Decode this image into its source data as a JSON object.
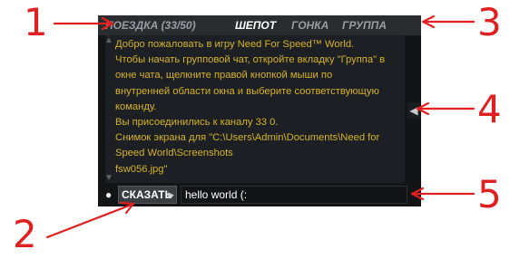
{
  "tabs": [
    {
      "label": "ПОЕЗДКА (33/50)",
      "active": false
    },
    {
      "label": "ШЕПОТ",
      "active": true
    },
    {
      "label": "ГОНКА",
      "active": false
    },
    {
      "label": "ГРУППА",
      "active": false
    }
  ],
  "messages": [
    "Добро пожаловать в игру Need For Speed™ World.",
    "Чтобы начать групповой чат, откройте вкладку \"Группа\" в",
    "окне чата, щелкните правой кнопкой мыши по",
    "внутренней области окна и выберите соответствующую",
    "команду.",
    "Вы присоединились к каналу 33 0.",
    "Снимок экрана для \"C:\\Users\\Admin\\Documents\\Need for",
    "Speed World\\Screenshots",
    "fsw056.jpg\""
  ],
  "input": {
    "say_label": "СКАЗАТЬ",
    "value": "hello world (:"
  },
  "icons": {
    "scroll_up": "chevron-up-icon",
    "scroll_down": "chevron-down-icon",
    "collapse": "chevron-left-icon",
    "say_arrow": "triangle-right-icon",
    "bullet": "bullet-icon"
  },
  "annotations": [
    "1",
    "2",
    "3",
    "4",
    "5"
  ],
  "colors": {
    "message_text": "#d7b227",
    "annotation": "#e02020",
    "active_tab": "#ffffff",
    "inactive_tab": "#9a9ea3"
  }
}
